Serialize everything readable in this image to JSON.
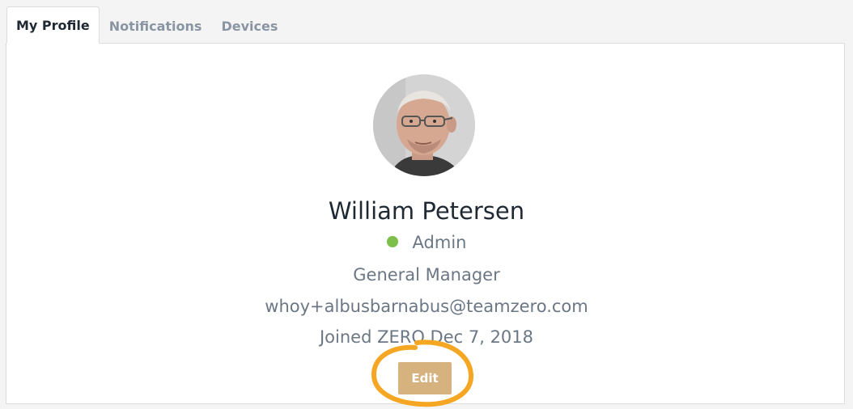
{
  "tabs": [
    {
      "label": "My Profile",
      "active": true
    },
    {
      "label": "Notifications",
      "active": false
    },
    {
      "label": "Devices",
      "active": false
    }
  ],
  "profile": {
    "name": "William Petersen",
    "role": "Admin",
    "status_color": "#7cc04b",
    "job_title": "General Manager",
    "email": "whoy+albusbarnabus@teamzero.com",
    "joined": "Joined ZERO Dec 7, 2018"
  },
  "actions": {
    "edit_label": "Edit"
  },
  "colors": {
    "edit_button": "#d6b37e",
    "highlight_circle": "#f5a623"
  }
}
